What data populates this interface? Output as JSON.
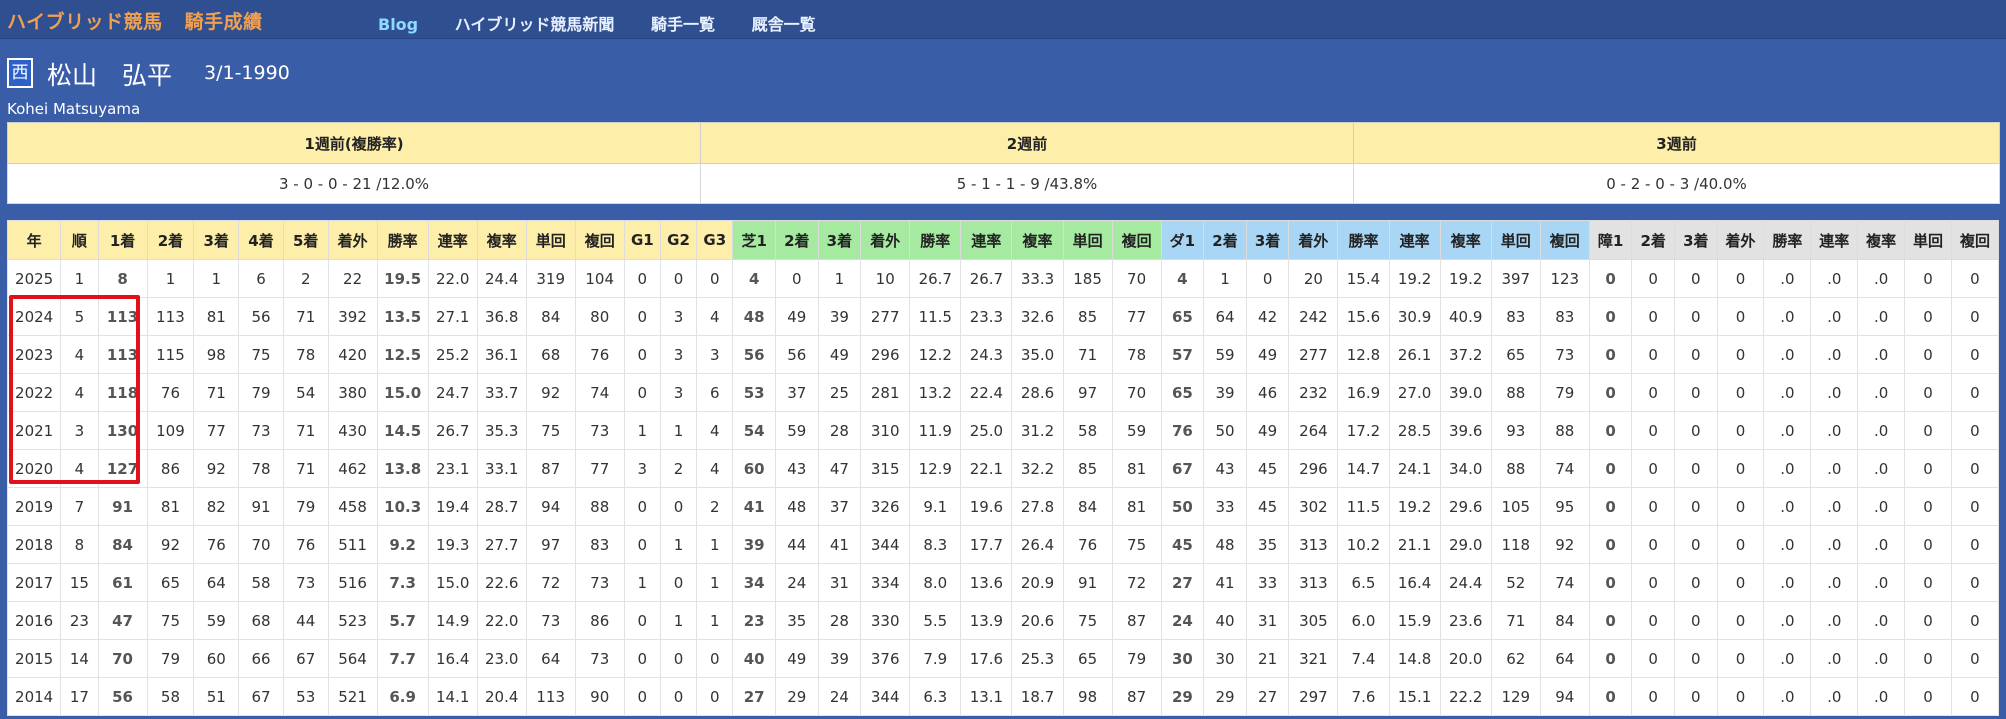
{
  "nav": {
    "brand": "ハイブリッド競馬",
    "section": "騎手成績",
    "links": [
      "Blog",
      "ハイブリッド競馬新聞",
      "騎手一覧",
      "厩舎一覧"
    ]
  },
  "jockey": {
    "affiliation": "西",
    "name": "松山　弘平",
    "birth": "3/1-1990",
    "romaji": "Kohei Matsuyama"
  },
  "recent": {
    "headers": [
      "1週前(複勝率)",
      "2週前",
      "3週前"
    ],
    "values": [
      "3 - 0 - 0 - 21 /12.0%",
      "5 - 1 - 1 - 9 /43.8%",
      "0 - 2 - 0 - 3 /40.0%"
    ]
  },
  "stats": {
    "headers": [
      "年",
      "順",
      "1着",
      "2着",
      "3着",
      "4着",
      "5着",
      "着外",
      "勝率",
      "連率",
      "複率",
      "単回",
      "複回",
      "G1",
      "G2",
      "G3",
      "芝1",
      "2着",
      "3着",
      "着外",
      "勝率",
      "連率",
      "複率",
      "単回",
      "複回",
      "ダ1",
      "2着",
      "3着",
      "着外",
      "勝率",
      "連率",
      "複率",
      "単回",
      "複回",
      "障1",
      "2着",
      "3着",
      "着外",
      "勝率",
      "連率",
      "複率",
      "単回",
      "複回"
    ],
    "rows": [
      [
        "2025",
        "1",
        "8",
        "1",
        "1",
        "6",
        "2",
        "22",
        "19.5",
        "22.0",
        "24.4",
        "319",
        "104",
        "0",
        "0",
        "0",
        "4",
        "0",
        "1",
        "10",
        "26.7",
        "26.7",
        "33.3",
        "185",
        "70",
        "4",
        "1",
        "0",
        "20",
        "15.4",
        "19.2",
        "19.2",
        "397",
        "123",
        "0",
        "0",
        "0",
        "0",
        ".0",
        ".0",
        ".0",
        "0",
        "0"
      ],
      [
        "2024",
        "5",
        "113",
        "113",
        "81",
        "56",
        "71",
        "392",
        "13.5",
        "27.1",
        "36.8",
        "84",
        "80",
        "0",
        "3",
        "4",
        "48",
        "49",
        "39",
        "277",
        "11.5",
        "23.3",
        "32.6",
        "85",
        "77",
        "65",
        "64",
        "42",
        "242",
        "15.6",
        "30.9",
        "40.9",
        "83",
        "83",
        "0",
        "0",
        "0",
        "0",
        ".0",
        ".0",
        ".0",
        "0",
        "0"
      ],
      [
        "2023",
        "4",
        "113",
        "115",
        "98",
        "75",
        "78",
        "420",
        "12.5",
        "25.2",
        "36.1",
        "68",
        "76",
        "0",
        "3",
        "3",
        "56",
        "56",
        "49",
        "296",
        "12.2",
        "24.3",
        "35.0",
        "71",
        "78",
        "57",
        "59",
        "49",
        "277",
        "12.8",
        "26.1",
        "37.2",
        "65",
        "73",
        "0",
        "0",
        "0",
        "0",
        ".0",
        ".0",
        ".0",
        "0",
        "0"
      ],
      [
        "2022",
        "4",
        "118",
        "76",
        "71",
        "79",
        "54",
        "380",
        "15.0",
        "24.7",
        "33.7",
        "92",
        "74",
        "0",
        "3",
        "6",
        "53",
        "37",
        "25",
        "281",
        "13.2",
        "22.4",
        "28.6",
        "97",
        "70",
        "65",
        "39",
        "46",
        "232",
        "16.9",
        "27.0",
        "39.0",
        "88",
        "79",
        "0",
        "0",
        "0",
        "0",
        ".0",
        ".0",
        ".0",
        "0",
        "0"
      ],
      [
        "2021",
        "3",
        "130",
        "109",
        "77",
        "73",
        "71",
        "430",
        "14.5",
        "26.7",
        "35.3",
        "75",
        "73",
        "1",
        "1",
        "4",
        "54",
        "59",
        "28",
        "310",
        "11.9",
        "25.0",
        "31.2",
        "58",
        "59",
        "76",
        "50",
        "49",
        "264",
        "17.2",
        "28.5",
        "39.6",
        "93",
        "88",
        "0",
        "0",
        "0",
        "0",
        ".0",
        ".0",
        ".0",
        "0",
        "0"
      ],
      [
        "2020",
        "4",
        "127",
        "86",
        "92",
        "78",
        "71",
        "462",
        "13.8",
        "23.1",
        "33.1",
        "87",
        "77",
        "3",
        "2",
        "4",
        "60",
        "43",
        "47",
        "315",
        "12.9",
        "22.1",
        "32.2",
        "85",
        "81",
        "67",
        "43",
        "45",
        "296",
        "14.7",
        "24.1",
        "34.0",
        "88",
        "74",
        "0",
        "0",
        "0",
        "0",
        ".0",
        ".0",
        ".0",
        "0",
        "0"
      ],
      [
        "2019",
        "7",
        "91",
        "81",
        "82",
        "91",
        "79",
        "458",
        "10.3",
        "19.4",
        "28.7",
        "94",
        "88",
        "0",
        "0",
        "2",
        "41",
        "48",
        "37",
        "326",
        "9.1",
        "19.6",
        "27.8",
        "84",
        "81",
        "50",
        "33",
        "45",
        "302",
        "11.5",
        "19.2",
        "29.6",
        "105",
        "95",
        "0",
        "0",
        "0",
        "0",
        ".0",
        ".0",
        ".0",
        "0",
        "0"
      ],
      [
        "2018",
        "8",
        "84",
        "92",
        "76",
        "70",
        "76",
        "511",
        "9.2",
        "19.3",
        "27.7",
        "97",
        "83",
        "0",
        "1",
        "1",
        "39",
        "44",
        "41",
        "344",
        "8.3",
        "17.7",
        "26.4",
        "76",
        "75",
        "45",
        "48",
        "35",
        "313",
        "10.2",
        "21.1",
        "29.0",
        "118",
        "92",
        "0",
        "0",
        "0",
        "0",
        ".0",
        ".0",
        ".0",
        "0",
        "0"
      ],
      [
        "2017",
        "15",
        "61",
        "65",
        "64",
        "58",
        "73",
        "516",
        "7.3",
        "15.0",
        "22.6",
        "72",
        "73",
        "1",
        "0",
        "1",
        "34",
        "24",
        "31",
        "334",
        "8.0",
        "13.6",
        "20.9",
        "91",
        "72",
        "27",
        "41",
        "33",
        "313",
        "6.5",
        "16.4",
        "24.4",
        "52",
        "74",
        "0",
        "0",
        "0",
        "0",
        ".0",
        ".0",
        ".0",
        "0",
        "0"
      ],
      [
        "2016",
        "23",
        "47",
        "75",
        "59",
        "68",
        "44",
        "523",
        "5.7",
        "14.9",
        "22.0",
        "73",
        "86",
        "0",
        "1",
        "1",
        "23",
        "35",
        "28",
        "330",
        "5.5",
        "13.9",
        "20.6",
        "75",
        "87",
        "24",
        "40",
        "31",
        "305",
        "6.0",
        "15.9",
        "23.6",
        "71",
        "84",
        "0",
        "0",
        "0",
        "0",
        ".0",
        ".0",
        ".0",
        "0",
        "0"
      ],
      [
        "2015",
        "14",
        "70",
        "79",
        "60",
        "66",
        "67",
        "564",
        "7.7",
        "16.4",
        "23.0",
        "64",
        "73",
        "0",
        "0",
        "0",
        "40",
        "49",
        "39",
        "376",
        "7.9",
        "17.6",
        "25.3",
        "65",
        "79",
        "30",
        "30",
        "21",
        "321",
        "7.4",
        "14.8",
        "20.0",
        "62",
        "64",
        "0",
        "0",
        "0",
        "0",
        ".0",
        ".0",
        ".0",
        "0",
        "0"
      ],
      [
        "2014",
        "17",
        "56",
        "58",
        "51",
        "67",
        "53",
        "521",
        "6.9",
        "14.1",
        "20.4",
        "113",
        "90",
        "0",
        "0",
        "0",
        "27",
        "29",
        "24",
        "344",
        "6.3",
        "13.1",
        "18.7",
        "98",
        "87",
        "29",
        "29",
        "27",
        "297",
        "7.6",
        "15.1",
        "22.2",
        "129",
        "94",
        "0",
        "0",
        "0",
        "0",
        ".0",
        ".0",
        ".0",
        "0",
        "0"
      ]
    ]
  },
  "colors": {
    "page_bg": "#3a5da8",
    "nav_bg": "#2f4f91",
    "brand": "#f0a050",
    "header_yellow": "#fdeeaa",
    "header_green": "#a6eaa2",
    "header_blue": "#a8d6f4",
    "header_gray": "#e2e2e2",
    "highlight_box": "#e0111a"
  }
}
